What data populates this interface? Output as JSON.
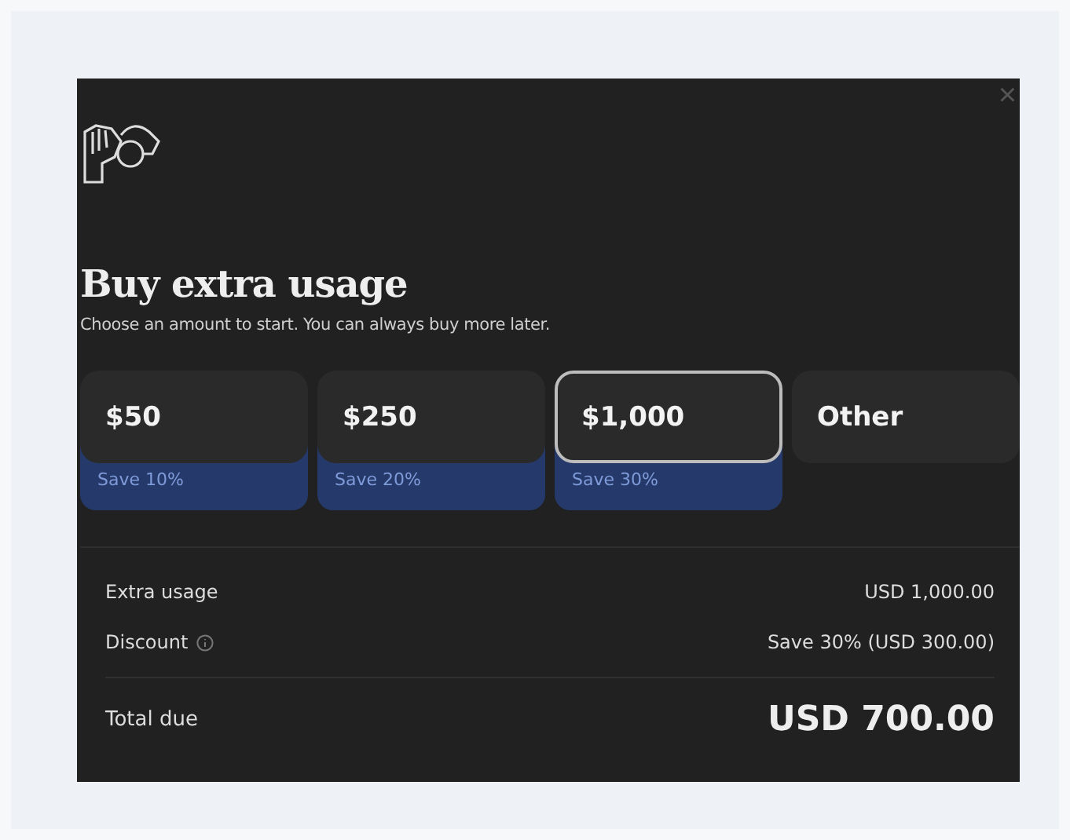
{
  "dialog": {
    "close_label": "×",
    "title": "Buy extra usage",
    "subtitle": "Choose an amount to start. You can always buy more later.",
    "options": [
      {
        "amount": "$50",
        "badge": "Save 10%",
        "selected": false
      },
      {
        "amount": "$250",
        "badge": "Save 20%",
        "selected": false
      },
      {
        "amount": "$1,000",
        "badge": "Save 30%",
        "selected": true
      },
      {
        "amount": "Other",
        "selected": false
      }
    ],
    "summary": [
      {
        "label": "Extra usage",
        "value": "USD 1,000.00",
        "info": false
      },
      {
        "label": "Discount",
        "value": "Save 30% (USD 300.00)",
        "info": true
      }
    ],
    "total": {
      "label": "Total due",
      "value": "USD 700.00"
    }
  }
}
